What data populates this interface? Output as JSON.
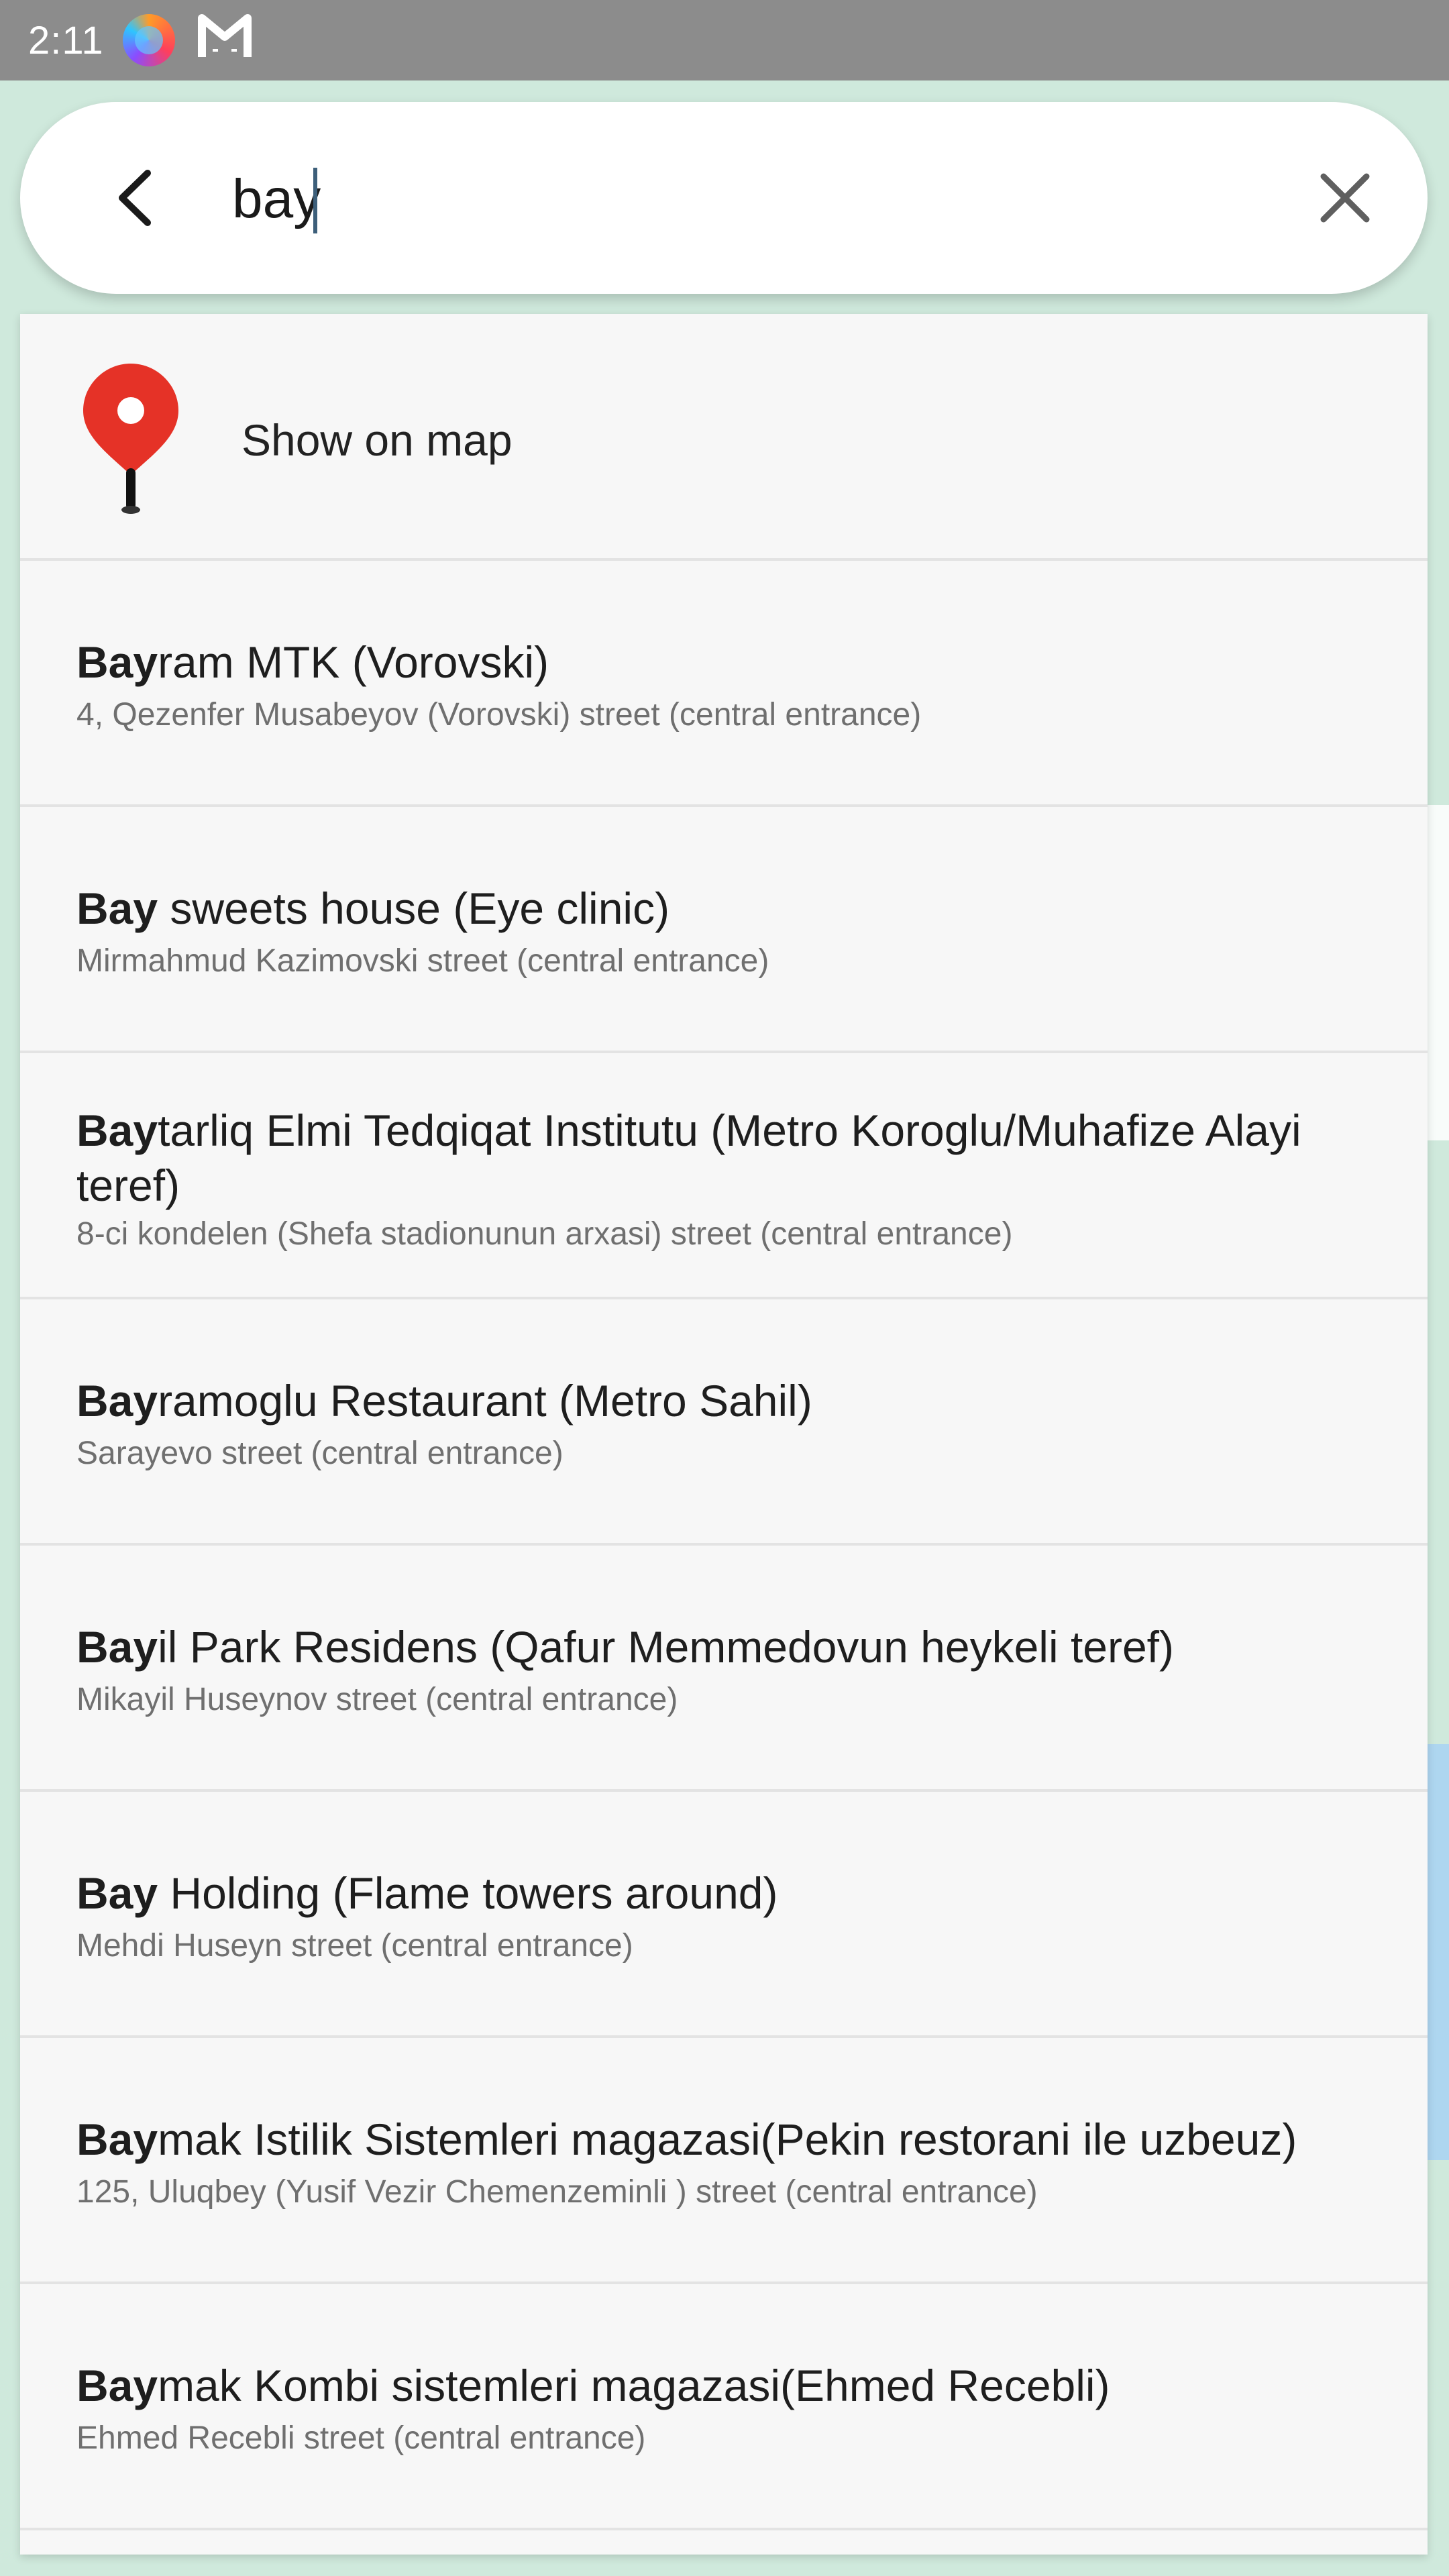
{
  "status_bar": {
    "time": "2:11",
    "icons": [
      "firefox-icon",
      "mail-cat-icon"
    ]
  },
  "search": {
    "query": "bay",
    "back_icon": "back-arrow-icon",
    "clear_icon": "close-icon"
  },
  "show_on_map": {
    "label": "Show on map",
    "icon": "map-pin-icon",
    "pin_color": "#e53227"
  },
  "results": [
    {
      "match": "Bay",
      "rest": "ram MTK (Vorovski)",
      "subtitle": "4, Qezenfer Musabeyov (Vorovski) street (central entrance)"
    },
    {
      "match": "Bay",
      "rest": " sweets house (Eye clinic)",
      "subtitle": "Mirmahmud Kazimovski street (central entrance)"
    },
    {
      "match": "Bay",
      "rest": "tarliq Elmi Tedqiqat Institutu (Metro Koroglu/Muhafize Alayi teref)",
      "subtitle": "8-ci kondelen (Shefa stadionunun arxasi) street (central entrance)"
    },
    {
      "match": "Bay",
      "rest": "ramoglu Restaurant (Metro Sahil)",
      "subtitle": "Sarayevo street (central entrance)"
    },
    {
      "match": "Bay",
      "rest": "il Park Residens (Qafur Memmedovun heykeli teref)",
      "subtitle": "Mikayil Huseynov street (central entrance)"
    },
    {
      "match": "Bay",
      "rest": " Holding (Flame towers around)",
      "subtitle": "Mehdi Huseyn street (central entrance)"
    },
    {
      "match": "Bay",
      "rest": "mak Istilik Sistemleri magazasi(Pekin restorani ile uzbeuz)",
      "subtitle": "125, Uluqbey (Yusif Vezir Chemenzeminli ) street (central entrance)"
    },
    {
      "match": "Bay",
      "rest": "mak Kombi sistemleri magazasi(Ehmed Recebli)",
      "subtitle": "Ehmed Recebli street (central entrance)"
    }
  ],
  "colors": {
    "status_bar": "#8c8c8c",
    "panel": "#f7f7f7",
    "divider": "#e3e3e3",
    "subtitle_text": "#6f6f6f"
  }
}
